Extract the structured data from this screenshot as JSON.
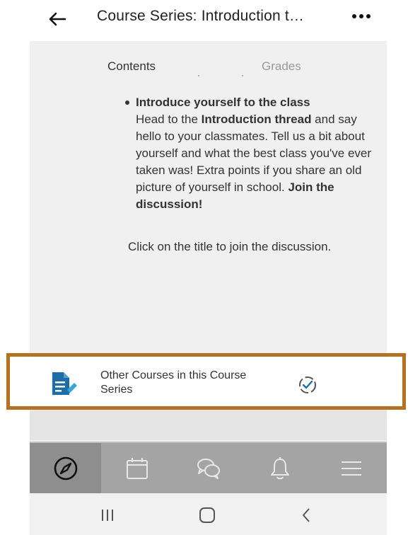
{
  "header": {
    "title": "Course Series: Introduction t…",
    "back_icon": "arrow-left-icon",
    "more_icon": "more-horizontal-icon"
  },
  "tabs": [
    {
      "label": "Contents",
      "state": "active"
    },
    {
      "label": "Grades",
      "state": "inactive"
    }
  ],
  "content": {
    "bullet_title": "Introduce yourself to the class",
    "bullet_text_1": "Head to the ",
    "bullet_bold_1": "Introduction thread",
    "bullet_text_2": " and say hello to your classmates. Tell us a bit about yourself and what the best class you've ever taken was! Extra points if you share an old picture of yourself in school. ",
    "bullet_bold_2": "Join the discussion!",
    "cta_text": "Click on the title to join the discussion."
  },
  "highlighted_item": {
    "label": "Other Courses in this Course Series",
    "icon": "document-edit-icon",
    "status_icon": "progress-check-icon",
    "highlight_color": "#b8701f"
  },
  "bottom_nav": [
    {
      "icon": "compass-icon",
      "active": true
    },
    {
      "icon": "calendar-icon",
      "active": false
    },
    {
      "icon": "chat-bubbles-icon",
      "active": false
    },
    {
      "icon": "bell-icon",
      "active": false
    },
    {
      "icon": "menu-icon",
      "active": false
    }
  ],
  "system_nav": [
    "recent-apps-icon",
    "home-icon",
    "back-chevron-icon"
  ],
  "colors": {
    "accent": "#1b6ea8",
    "highlight": "#b8701f",
    "nav_bg": "#a4a4a4",
    "nav_active_bg": "#8e8e8e"
  }
}
